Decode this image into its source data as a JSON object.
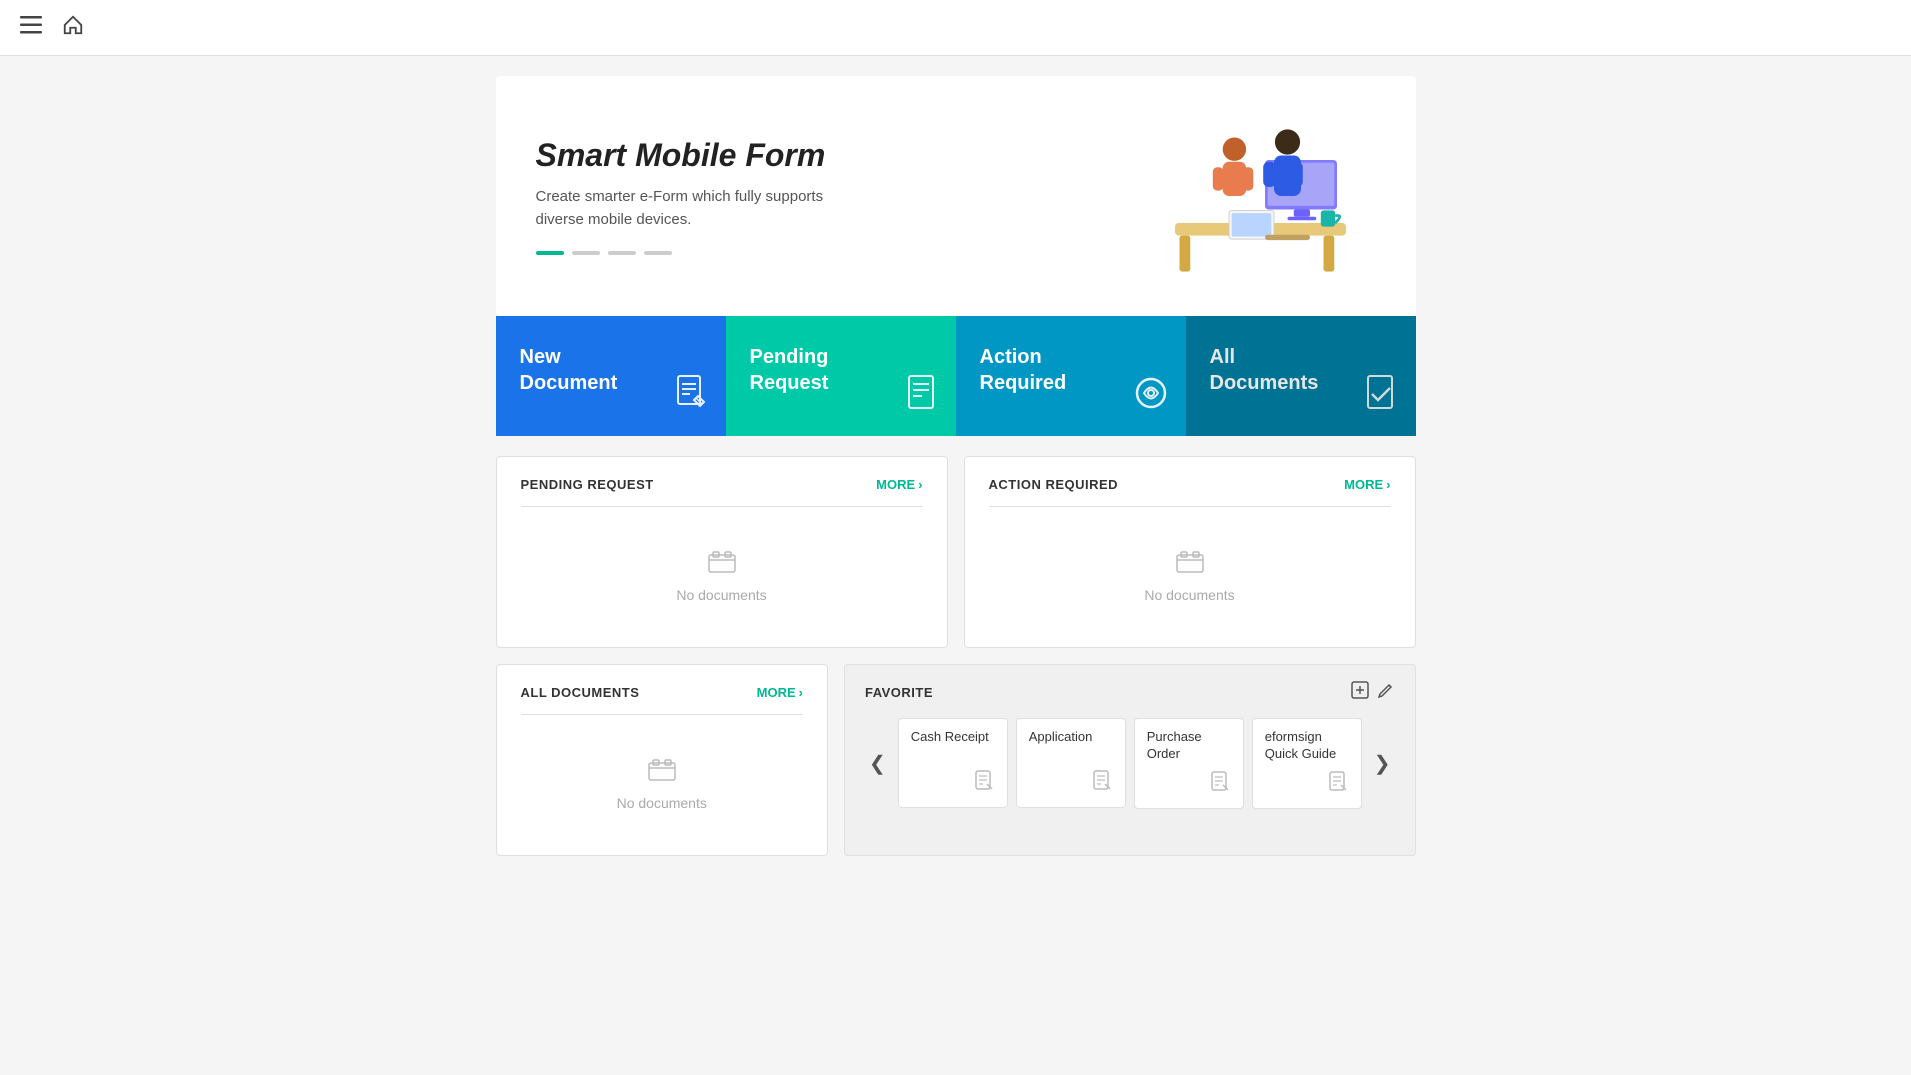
{
  "nav": {
    "hamburger": "☰",
    "home": "⌂"
  },
  "banner": {
    "title": "Smart Mobile Form",
    "subtitle": "Create smarter e-Form which fully supports diverse mobile devices.",
    "dots": [
      true,
      false,
      false,
      false
    ]
  },
  "quick_actions": [
    {
      "id": "new-document",
      "label": "New\nDocument",
      "icon": "✏️"
    },
    {
      "id": "pending-request",
      "label": "Pending\nRequest",
      "icon": "📄"
    },
    {
      "id": "action-required",
      "label": "Action\nRequired",
      "icon": "🔄"
    },
    {
      "id": "all-documents",
      "label": "All\nDocuments",
      "icon": "📁"
    }
  ],
  "pending_request": {
    "title": "PENDING REQUEST",
    "more": "MORE",
    "no_docs": "No documents"
  },
  "action_required": {
    "title": "ACTION REQUIRED",
    "more": "MORE",
    "no_docs": "No documents"
  },
  "all_documents": {
    "title": "ALL DOCUMENTS",
    "more": "MORE",
    "no_docs": "No documents"
  },
  "favorite": {
    "title": "FAVORITE",
    "add_btn": "＋",
    "edit_btn": "✏",
    "items": [
      {
        "name": "Cash Receipt",
        "icon": "📋"
      },
      {
        "name": "Application",
        "icon": "📋"
      },
      {
        "name": "Purchase Order",
        "icon": "📋"
      },
      {
        "name": "eformsign Quick Guide",
        "icon": "📋"
      }
    ],
    "prev": "❮",
    "next": "❯"
  }
}
